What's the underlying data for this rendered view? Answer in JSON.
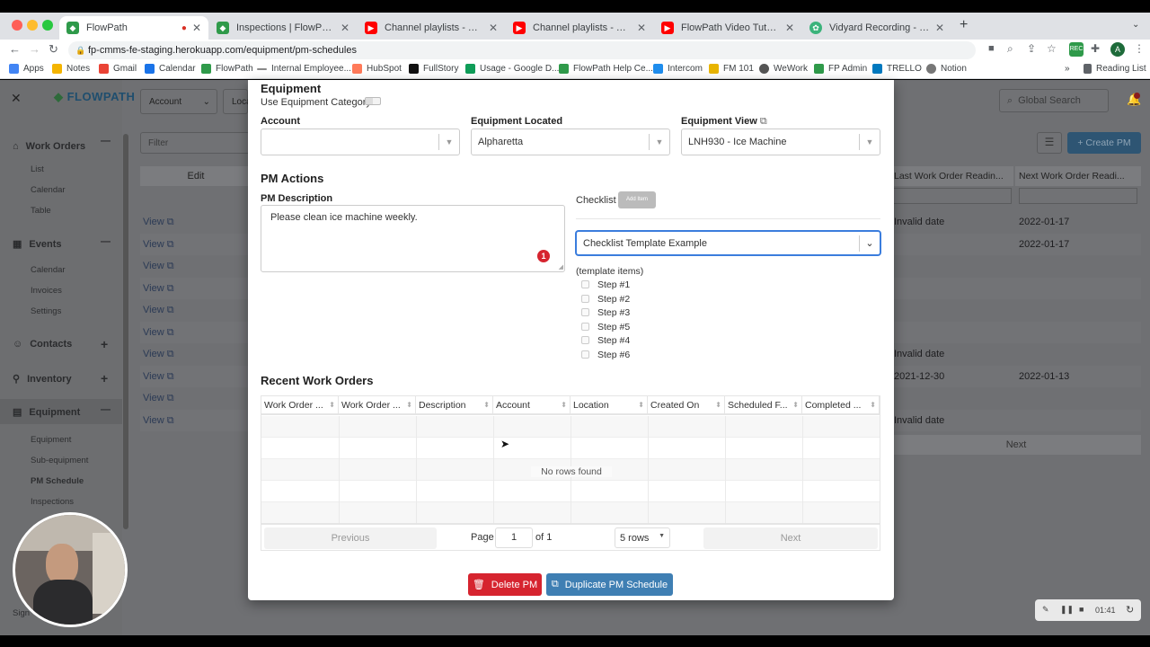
{
  "browser": {
    "tabs": [
      {
        "title": "FlowPath",
        "icon": "flowpath-icon"
      },
      {
        "title": "Inspections | FlowPath Help Ce...",
        "icon": "flowpath-icon"
      },
      {
        "title": "Channel playlists - YouTube Stu...",
        "icon": "youtube-icon"
      },
      {
        "title": "Channel playlists - YouTube Stu...",
        "icon": "youtube-icon"
      },
      {
        "title": "FlowPath Video Tutorials - YouT...",
        "icon": "youtube-icon"
      },
      {
        "title": "Vidyard Recording - Vidyard",
        "icon": "vidyard-icon"
      }
    ],
    "url": "fp-cmms-fe-staging.herokuapp.com/equipment/pm-schedules",
    "bookmarks": [
      "Apps",
      "Notes",
      "Gmail",
      "Calendar",
      "FlowPath",
      "Internal Employee...",
      "HubSpot",
      "FullStory",
      "Usage - Google D...",
      "FlowPath Help Ce...",
      "Intercom",
      "FM 101",
      "WeWork",
      "FP Admin",
      "TRELLO",
      "Notion"
    ],
    "reading_list": "Reading List",
    "profile_initial": "A"
  },
  "app": {
    "logo": "FLOWPATH",
    "sidebar": {
      "sections": [
        {
          "label": "Work Orders",
          "toggle": "—",
          "items": [
            "List",
            "Calendar",
            "Table"
          ]
        },
        {
          "label": "Events",
          "toggle": "—",
          "items": [
            "Calendar",
            "Invoices",
            "Settings"
          ]
        },
        {
          "label": "Contacts",
          "toggle": "+",
          "items": []
        },
        {
          "label": "Inventory",
          "toggle": "+",
          "items": []
        },
        {
          "label": "Equipment",
          "toggle": "—",
          "items": [
            "Equipment",
            "Sub-equipment",
            "PM Schedule",
            "Inspections"
          ]
        }
      ],
      "sign": "Sign"
    },
    "topbar": {
      "account": "Account",
      "location_partial": "Loca",
      "search_placeholder": "Global Search"
    },
    "filter_placeholder": "Filter",
    "create_pm": "+ Create PM",
    "table": {
      "col_edit": "Edit",
      "col_last": "Last Work Order Readin...",
      "col_next": "Next Work Order Readi...",
      "view_label": "View",
      "rows": [
        {
          "last": "Invalid date",
          "next": "2022-01-17"
        },
        {
          "last": "",
          "next": "2022-01-17"
        },
        {
          "last": "",
          "next": ""
        },
        {
          "last": "",
          "next": ""
        },
        {
          "last": "",
          "next": ""
        },
        {
          "last": "",
          "next": ""
        },
        {
          "last": "Invalid date",
          "next": ""
        },
        {
          "last": "2021-12-30",
          "next": "2022-01-13"
        },
        {
          "last": "",
          "next": ""
        },
        {
          "last": "Invalid date",
          "next": ""
        }
      ],
      "next_label": "Next"
    }
  },
  "modal": {
    "equipment_heading": "Equipment",
    "use_category_label": "Use Equipment Category",
    "account_label": "Account",
    "account_value": "",
    "located_label": "Equipment Located",
    "located_value": "Alpharetta",
    "view_label": "Equipment View",
    "view_value": "LNH930 - Ice Machine",
    "pm_actions_heading": "PM Actions",
    "pm_description_label": "PM Description",
    "pm_description_value": "Please clean ice machine weekly.",
    "error_count": "1",
    "checklist_label": "Checklist",
    "add_item_label": "Add Item",
    "checklist_template": "Checklist Template Example",
    "template_items_label": "(template items)",
    "steps": [
      "Step #1",
      "Step #2",
      "Step #3",
      "Step #5",
      "Step #4",
      "Step #6"
    ],
    "recent_heading": "Recent Work Orders",
    "columns": [
      "Work Order ...",
      "Work Order ...",
      "Description",
      "Account",
      "Location",
      "Created On",
      "Scheduled F...",
      "Completed ..."
    ],
    "empty_text": "No rows found",
    "pager": {
      "previous": "Previous",
      "page_label": "Page",
      "page_value": "1",
      "of_label": "of 1",
      "rows": "5 rows",
      "next": "Next"
    },
    "delete_label": "Delete PM",
    "duplicate_label": "Duplicate PM Schedule"
  },
  "recorder": {
    "time": "01:41"
  },
  "colors": {
    "accent": "#2c7fbd",
    "danger": "#d6242f",
    "duplicate": "#3f7fb3"
  }
}
